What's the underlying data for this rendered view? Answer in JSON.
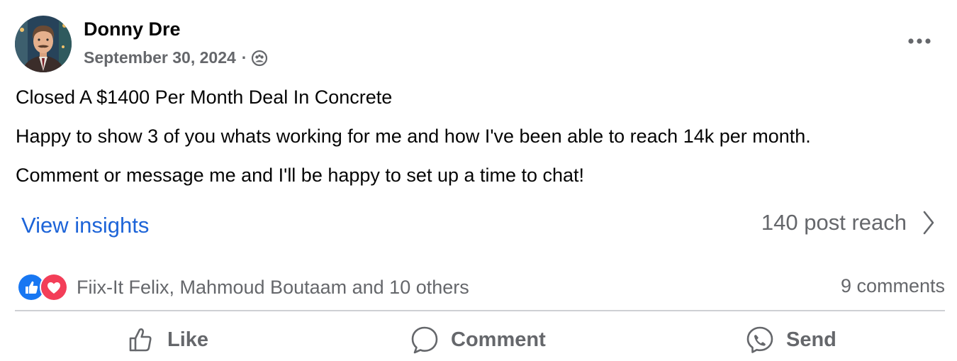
{
  "post": {
    "author": "Donny Dre",
    "date": "September 30, 2024",
    "separator": "·",
    "audience_icon": "groups-icon",
    "lines": [
      "Closed A $1400 Per Month Deal In Concrete",
      "Happy to show 3 of you whats working for me and how I've been able to reach 14k per month.",
      "Comment or message me and I'll be happy to set up a time to chat!"
    ]
  },
  "insights": {
    "link": "View insights",
    "reach": "140 post reach"
  },
  "engagement": {
    "reactions": [
      "like",
      "love"
    ],
    "reactors": "Fiix-It Felix, Mahmoud Boutaam and 10 others",
    "comments": "9 comments"
  },
  "actions": [
    {
      "label": "Like",
      "icon": "like-icon"
    },
    {
      "label": "Comment",
      "icon": "comment-icon"
    },
    {
      "label": "Send",
      "icon": "messenger-icon"
    }
  ],
  "colors": {
    "link": "#1d64d8",
    "secondary_text": "#65676b",
    "like_blue": "#1877f2",
    "love_red": "#f33e58",
    "divider": "#ced0d4"
  }
}
